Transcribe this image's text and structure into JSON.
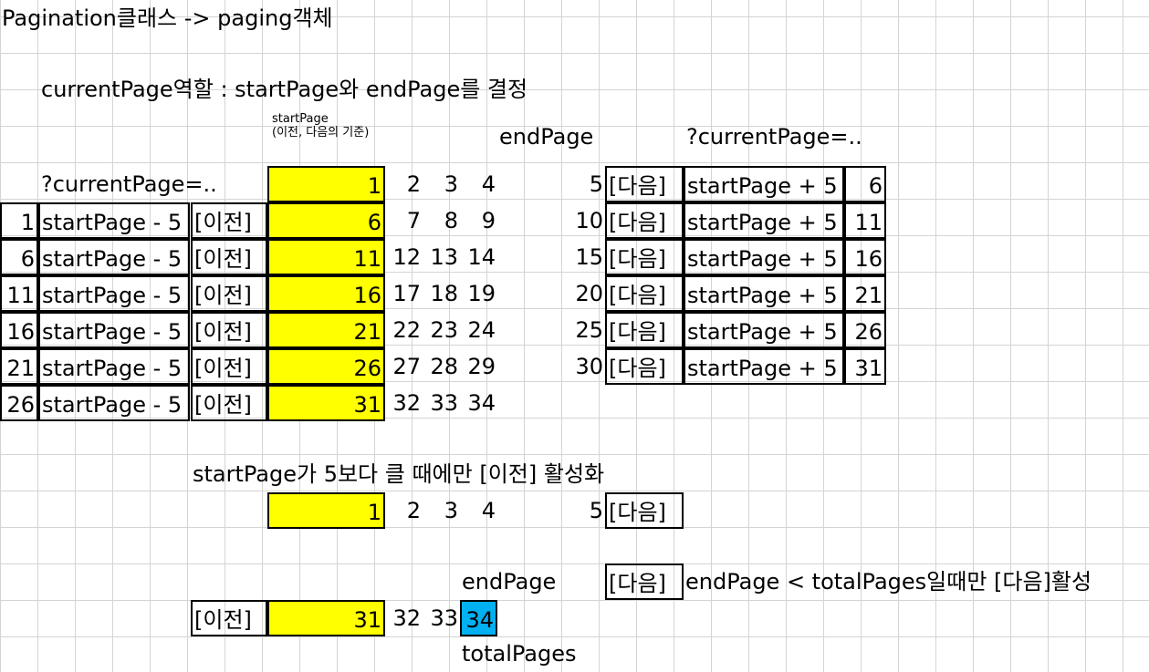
{
  "title": "Pagination클래스 -> paging객체",
  "subtitle": "currentPage역할 : startPage와 endPage를 결정",
  "start_page_label": "startPage\n(이전, 다음의 기준)",
  "end_page_label": "endPage",
  "current_page_label": "?currentPage=..",
  "current_page_label_left": "?currentPage=..",
  "prev_label": "[이전]",
  "next_label": "[다음]",
  "minus_formula": "startPage - 5",
  "plus_formula": "startPage + 5",
  "rows": [
    {
      "prev_value": "",
      "pages": [
        "1",
        "2",
        "3",
        "4",
        "5"
      ],
      "next_value": "6"
    },
    {
      "prev_value": "1",
      "pages": [
        "6",
        "7",
        "8",
        "9",
        "10"
      ],
      "next_value": "11"
    },
    {
      "prev_value": "6",
      "pages": [
        "11",
        "12",
        "13",
        "14",
        "15"
      ],
      "next_value": "16"
    },
    {
      "prev_value": "11",
      "pages": [
        "16",
        "17",
        "18",
        "19",
        "20"
      ],
      "next_value": "21"
    },
    {
      "prev_value": "16",
      "pages": [
        "21",
        "22",
        "23",
        "24",
        "25"
      ],
      "next_value": "26"
    },
    {
      "prev_value": "21",
      "pages": [
        "26",
        "27",
        "28",
        "29",
        "30"
      ],
      "next_value": "31"
    },
    {
      "prev_value": "26",
      "pages": [
        "31",
        "32",
        "33",
        "34"
      ],
      "next_value": ""
    }
  ],
  "note_prev": "startPage가 5보다 클 때에만 [이전] 활성화",
  "example1_pages": [
    "1",
    "2",
    "3",
    "4",
    "5"
  ],
  "example2_end_label": "endPage",
  "note_next": "endPage < totalPages일때만 [다음]활성",
  "example2_pages": [
    "31",
    "32",
    "33",
    "34"
  ],
  "total_pages_label": "totalPages",
  "colors": {
    "highlight_yellow": "#ffff00",
    "highlight_blue": "#00b0f0",
    "grid": "#d4d4d4"
  }
}
